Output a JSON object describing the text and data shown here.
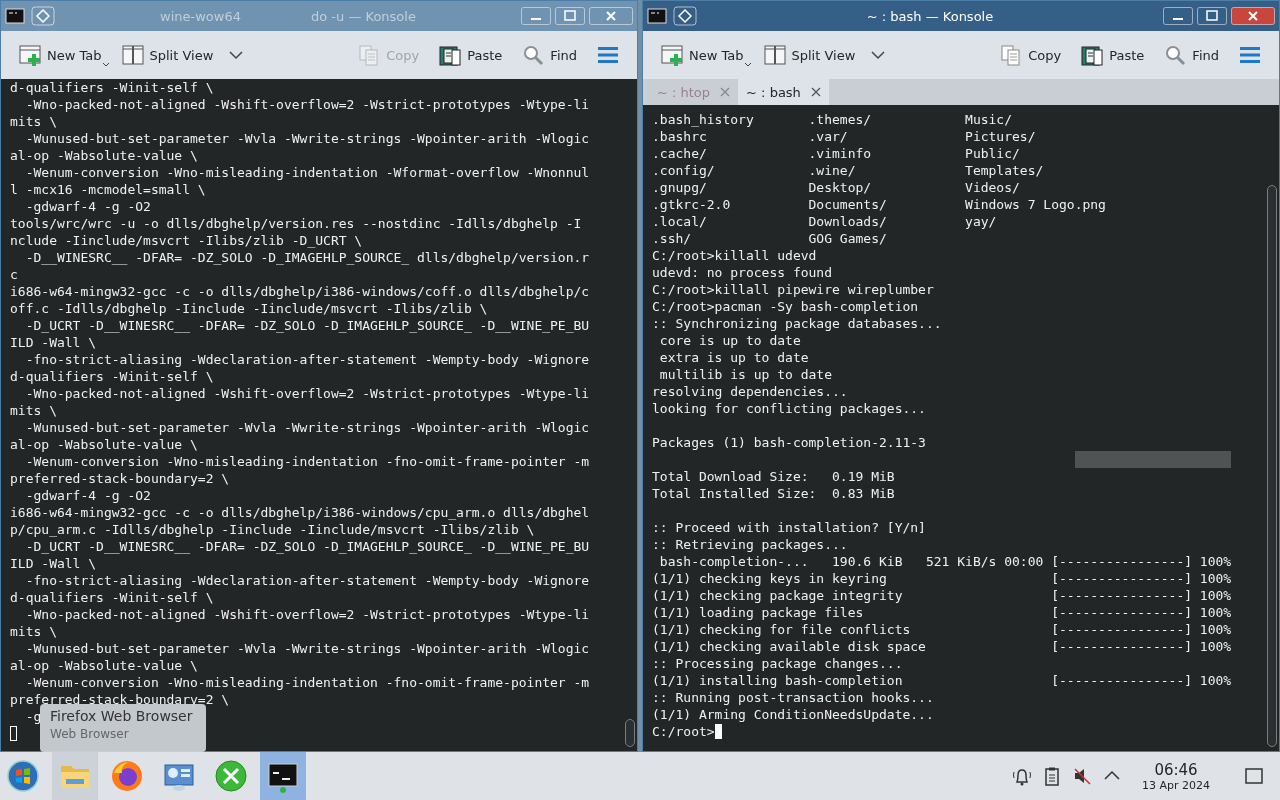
{
  "windows": [
    {
      "active": false,
      "title_parts": [
        "wine-wow64",
        "do -u — Konsole"
      ],
      "toolbar": [
        {
          "kind": "new-tab",
          "label": "New Tab",
          "disabled": false
        },
        {
          "kind": "split-view",
          "label": "Split View",
          "disabled": false
        },
        {
          "kind": "copy",
          "label": "Copy",
          "disabled": true
        },
        {
          "kind": "paste",
          "label": "Paste",
          "disabled": false
        },
        {
          "kind": "find",
          "label": "Find",
          "disabled": false
        },
        {
          "kind": "menu",
          "disabled": false
        }
      ],
      "lines": [
        {
          "kind": "text",
          "text": "d-qualifiers -Winit-self \\"
        },
        {
          "kind": "text",
          "text": "  -Wno-packed-not-aligned -Wshift-overflow=2 -Wstrict-prototypes -Wtype-li"
        },
        {
          "kind": "text",
          "text": "mits \\"
        },
        {
          "kind": "text",
          "text": "  -Wunused-but-set-parameter -Wvla -Wwrite-strings -Wpointer-arith -Wlogic"
        },
        {
          "kind": "text",
          "text": "al-op -Wabsolute-value \\"
        },
        {
          "kind": "text",
          "text": "  -Wenum-conversion -Wno-misleading-indentation -Wformat-overflow -Wnonnul"
        },
        {
          "kind": "text",
          "text": "l -mcx16 -mcmodel=small \\"
        },
        {
          "kind": "text",
          "text": "  -gdwarf-4 -g -O2"
        },
        {
          "kind": "text",
          "text": "tools/wrc/wrc -u -o dlls/dbghelp/version.res --nostdinc -Idlls/dbghelp -I"
        },
        {
          "kind": "text",
          "text": "nclude -Iinclude/msvcrt -Ilibs/zlib -D_UCRT \\"
        },
        {
          "kind": "text",
          "text": "  -D__WINESRC__ -DFAR= -DZ_SOLO -D_IMAGEHLP_SOURCE_ dlls/dbghelp/version.r"
        },
        {
          "kind": "text",
          "text": "c"
        },
        {
          "kind": "text",
          "text": "i686-w64-mingw32-gcc -c -o dlls/dbghelp/i386-windows/coff.o dlls/dbghelp/c"
        },
        {
          "kind": "text",
          "text": "off.c -Idlls/dbghelp -Iinclude -Iinclude/msvcrt -Ilibs/zlib \\"
        },
        {
          "kind": "text",
          "text": "  -D_UCRT -D__WINESRC__ -DFAR= -DZ_SOLO -D_IMAGEHLP_SOURCE_ -D__WINE_PE_BU"
        },
        {
          "kind": "text",
          "text": "ILD -Wall \\"
        },
        {
          "kind": "text",
          "text": "  -fno-strict-aliasing -Wdeclaration-after-statement -Wempty-body -Wignore"
        },
        {
          "kind": "text",
          "text": "d-qualifiers -Winit-self \\"
        },
        {
          "kind": "text",
          "text": "  -Wno-packed-not-aligned -Wshift-overflow=2 -Wstrict-prototypes -Wtype-li"
        },
        {
          "kind": "text",
          "text": "mits \\"
        },
        {
          "kind": "text",
          "text": "  -Wunused-but-set-parameter -Wvla -Wwrite-strings -Wpointer-arith -Wlogic"
        },
        {
          "kind": "text",
          "text": "al-op -Wabsolute-value \\"
        },
        {
          "kind": "text",
          "text": "  -Wenum-conversion -Wno-misleading-indentation -fno-omit-frame-pointer -m"
        },
        {
          "kind": "text",
          "text": "preferred-stack-boundary=2 \\"
        },
        {
          "kind": "text",
          "text": "  -gdwarf-4 -g -O2"
        },
        {
          "kind": "text",
          "text": "i686-w64-mingw32-gcc -c -o dlls/dbghelp/i386-windows/cpu_arm.o dlls/dbghel"
        },
        {
          "kind": "text",
          "text": "p/cpu_arm.c -Idlls/dbghelp -Iinclude -Iinclude/msvcrt -Ilibs/zlib \\"
        },
        {
          "kind": "text",
          "text": "  -D_UCRT -D__WINESRC__ -DFAR= -DZ_SOLO -D_IMAGEHLP_SOURCE_ -D__WINE_PE_BU"
        },
        {
          "kind": "text",
          "text": "ILD -Wall \\"
        },
        {
          "kind": "text",
          "text": "  -fno-strict-aliasing -Wdeclaration-after-statement -Wempty-body -Wignore"
        },
        {
          "kind": "text",
          "text": "d-qualifiers -Winit-self \\"
        },
        {
          "kind": "text",
          "text": "  -Wno-packed-not-aligned -Wshift-overflow=2 -Wstrict-prototypes -Wtype-li"
        },
        {
          "kind": "text",
          "text": "mits \\"
        },
        {
          "kind": "text",
          "text": "  -Wunused-but-set-parameter -Wvla -Wwrite-strings -Wpointer-arith -Wlogic"
        },
        {
          "kind": "text",
          "text": "al-op -Wabsolute-value \\"
        },
        {
          "kind": "text",
          "text": "  -Wenum-conversion -Wno-misleading-indentation -fno-omit-frame-pointer -m"
        },
        {
          "kind": "text",
          "text": "preferred-stack-boundary=2 \\"
        },
        {
          "kind": "text",
          "text": "  -g"
        },
        {
          "kind": "cursor",
          "cursor_filled": false
        }
      ]
    },
    {
      "active": true,
      "title_parts": [
        "~ : bash — Konsole"
      ],
      "toolbar": [
        {
          "kind": "new-tab",
          "label": "New Tab",
          "disabled": false
        },
        {
          "kind": "split-view",
          "label": "Split View",
          "disabled": false
        },
        {
          "kind": "copy",
          "label": "Copy",
          "disabled": false
        },
        {
          "kind": "paste",
          "label": "Paste",
          "disabled": false
        },
        {
          "kind": "find",
          "label": "Find",
          "disabled": false
        },
        {
          "kind": "menu",
          "disabled": false
        }
      ],
      "tabs": [
        {
          "label": "~ : htop",
          "selected": false
        },
        {
          "label": "~ : bash",
          "selected": true
        }
      ],
      "lines": [
        {
          "kind": "text",
          "text": ".bash_history       .themes/            Music/"
        },
        {
          "kind": "text",
          "text": ".bashrc             .var/               Pictures/"
        },
        {
          "kind": "text",
          "text": ".cache/             .viminfo            Public/"
        },
        {
          "kind": "text",
          "text": ".config/            .wine/              Templates/"
        },
        {
          "kind": "text",
          "text": ".gnupg/             Desktop/            Videos/"
        },
        {
          "kind": "text",
          "text": ".gtkrc-2.0          Documents/          Windows 7 Logo.png"
        },
        {
          "kind": "text",
          "text": ".local/             Downloads/          yay/"
        },
        {
          "kind": "text",
          "text": ".ssh/               GOG Games/"
        },
        {
          "kind": "text",
          "text": "C:/root>killall udevd"
        },
        {
          "kind": "text",
          "text": "udevd: no process found"
        },
        {
          "kind": "text",
          "text": "C:/root>killall pipewire wireplumber"
        },
        {
          "kind": "text",
          "text": "C:/root>pacman -Sy bash-completion"
        },
        {
          "kind": "text",
          "text": ":: Synchronizing package databases..."
        },
        {
          "kind": "text",
          "text": " core is up to date"
        },
        {
          "kind": "text",
          "text": " extra is up to date"
        },
        {
          "kind": "text",
          "text": " multilib is up to date"
        },
        {
          "kind": "text",
          "text": "resolving dependencies..."
        },
        {
          "kind": "text",
          "text": "looking for conflicting packages..."
        },
        {
          "kind": "blank"
        },
        {
          "kind": "text",
          "text": "Packages (1) bash-completion-2.11-3"
        },
        {
          "kind": "highlight"
        },
        {
          "kind": "text",
          "text": "Total Download Size:   0.19 MiB"
        },
        {
          "kind": "text",
          "text": "Total Installed Size:  0.83 MiB"
        },
        {
          "kind": "blank"
        },
        {
          "kind": "text",
          "text": ":: Proceed with installation? [Y/n]"
        },
        {
          "kind": "text",
          "text": ":: Retrieving packages..."
        },
        {
          "kind": "text",
          "text": " bash-completion-...   190.6 KiB   521 KiB/s 00:00 [----------------] 100%"
        },
        {
          "kind": "text",
          "text": "(1/1) checking keys in keyring                     [----------------] 100%"
        },
        {
          "kind": "text",
          "text": "(1/1) checking package integrity                   [----------------] 100%"
        },
        {
          "kind": "text",
          "text": "(1/1) loading package files                        [----------------] 100%"
        },
        {
          "kind": "text",
          "text": "(1/1) checking for file conflicts                  [----------------] 100%"
        },
        {
          "kind": "text",
          "text": "(1/1) checking available disk space                [----------------] 100%"
        },
        {
          "kind": "text",
          "text": ":: Processing package changes..."
        },
        {
          "kind": "text",
          "text": "(1/1) installing bash-completion                   [----------------] 100%"
        },
        {
          "kind": "text",
          "text": ":: Running post-transaction hooks..."
        },
        {
          "kind": "text",
          "text": "(1/1) Arming ConditionNeedsUpdate..."
        },
        {
          "kind": "prompt",
          "text": "C:/root>",
          "cursor_filled": true
        }
      ]
    }
  ],
  "tooltip": {
    "title": "Firefox Web Browser",
    "subtitle": "Web Browser"
  },
  "taskbar": {
    "tasks": [
      {
        "kind": "start",
        "selected": false
      },
      {
        "kind": "files",
        "selected": false
      },
      {
        "kind": "firefox",
        "selected": false
      },
      {
        "kind": "settings",
        "selected": false
      },
      {
        "kind": "tools",
        "selected": false
      },
      {
        "kind": "terminal",
        "selected": true
      }
    ],
    "tray": [
      {
        "kind": "bell"
      },
      {
        "kind": "clipboard"
      },
      {
        "kind": "volume-muted"
      },
      {
        "kind": "expand"
      }
    ],
    "clock": {
      "time": "06:46",
      "date": "13 Apr 2024"
    }
  }
}
